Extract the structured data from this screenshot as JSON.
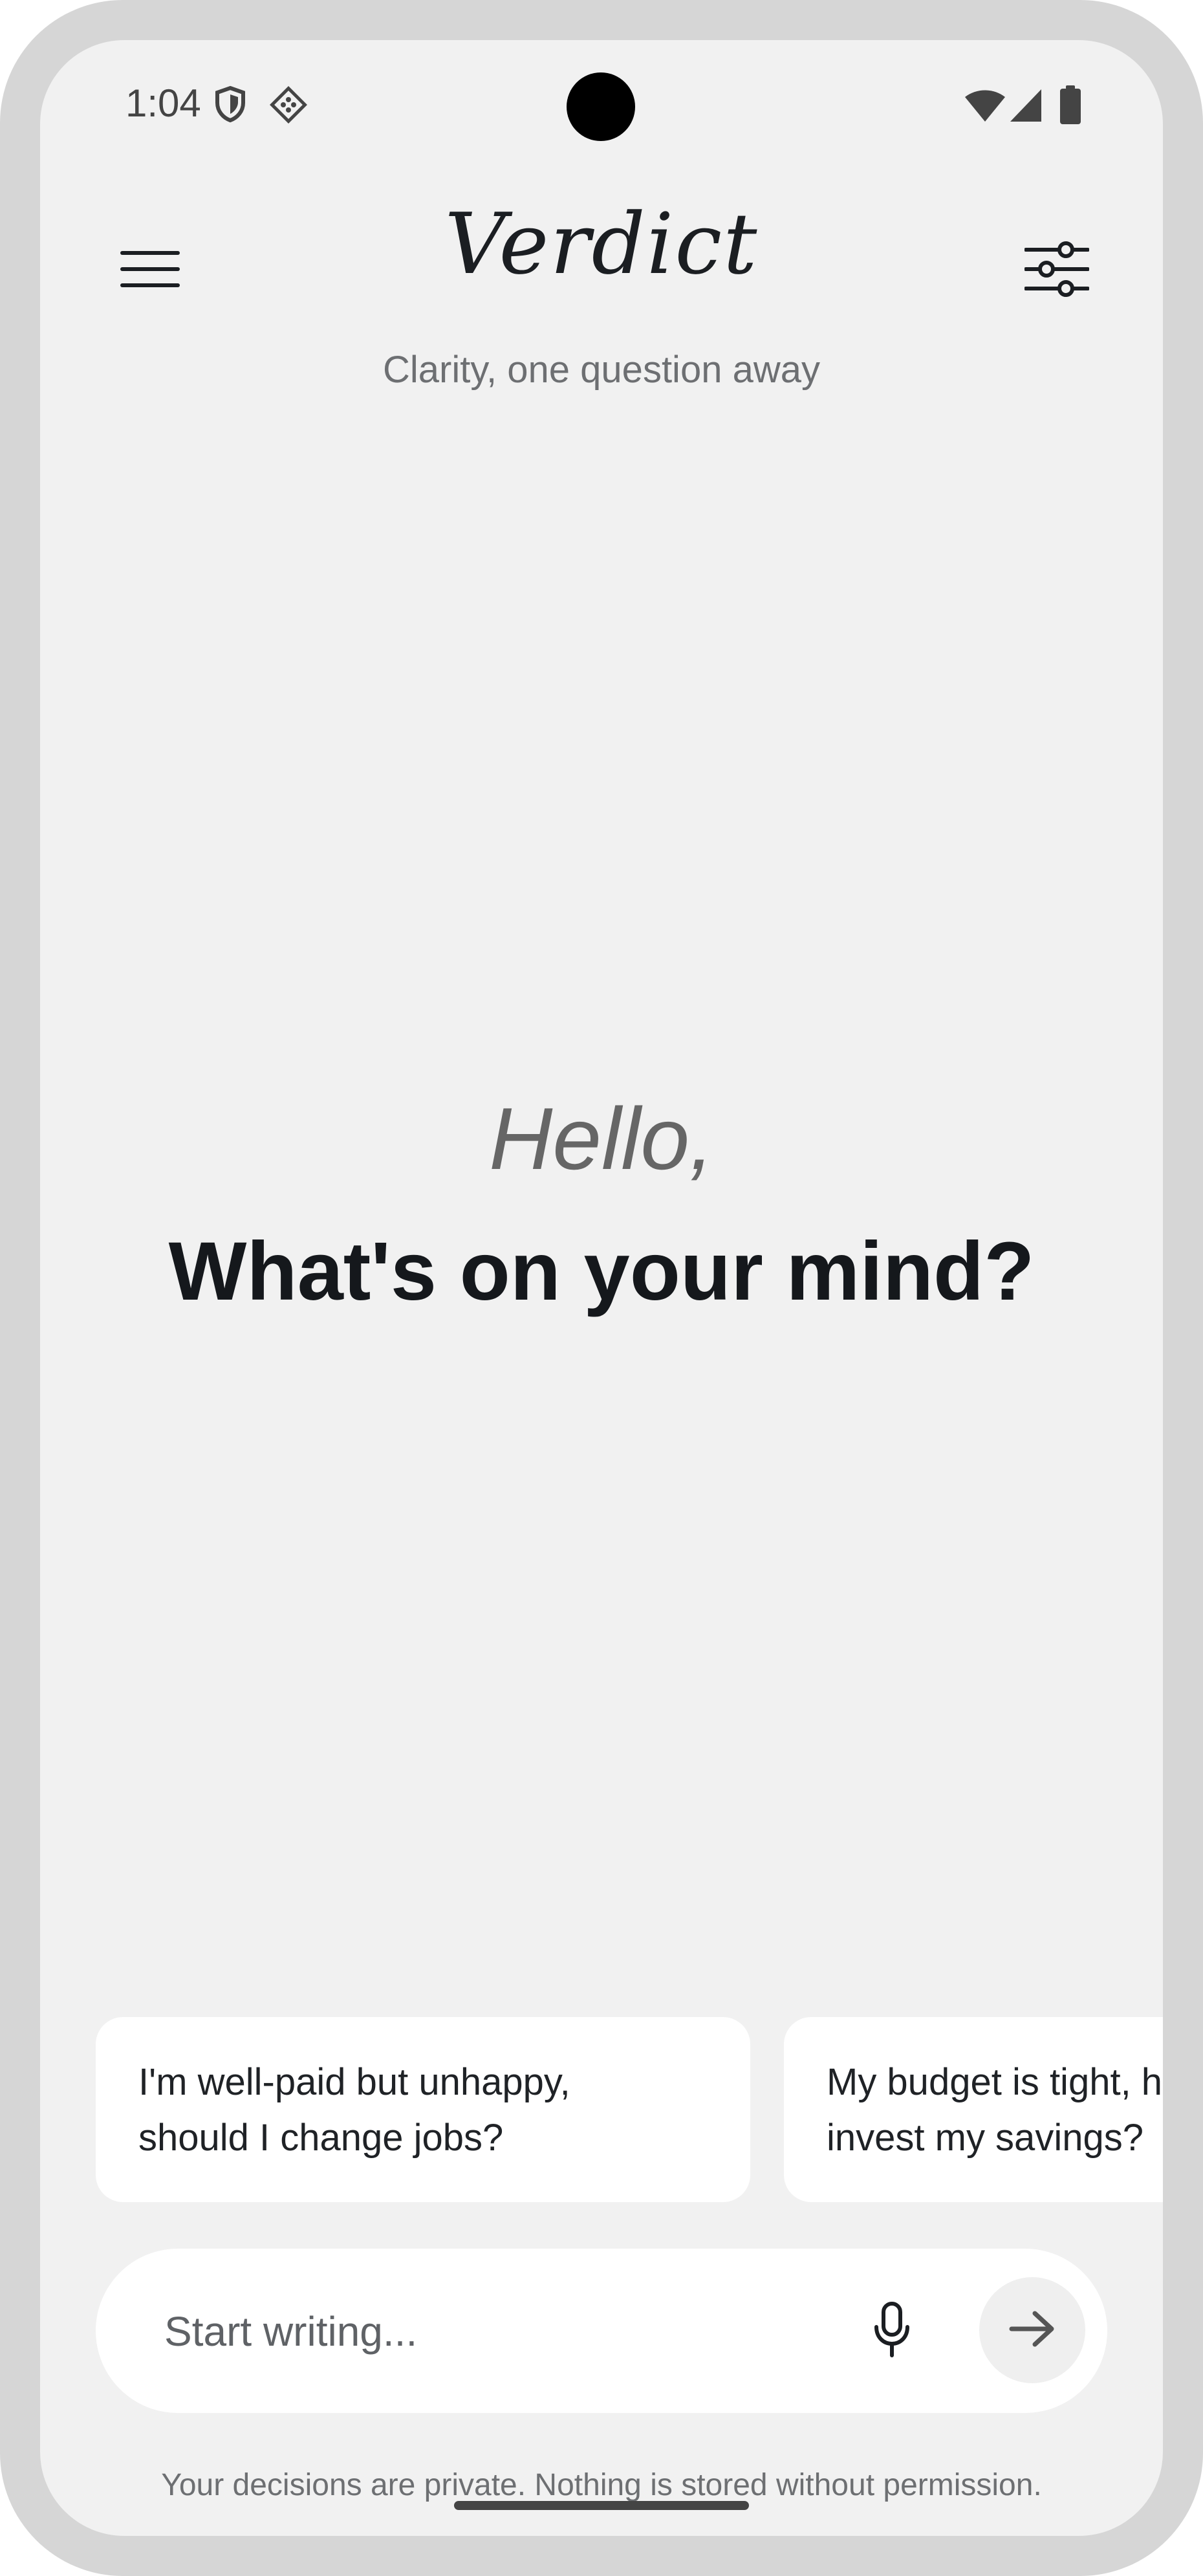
{
  "status_bar": {
    "time": "1:04",
    "icons": [
      "shield-icon",
      "diamond-dots-icon",
      "wifi-icon",
      "cellular-signal-icon",
      "battery-icon"
    ]
  },
  "header": {
    "brand": "Verdict",
    "tagline": "Clarity, one question away",
    "menu_icon": "hamburger-menu-icon",
    "settings_icon": "sliders-icon"
  },
  "main": {
    "greeting": "Hello,",
    "prompt": "What's on your mind?"
  },
  "suggestions": [
    {
      "text": "I'm well-paid but unhappy,\nshould I change jobs?"
    },
    {
      "text": "My budget is tight, h\ninvest my savings?"
    }
  ],
  "composer": {
    "placeholder": "Start writing...",
    "mic_icon": "microphone-icon",
    "send_icon": "arrow-right-icon"
  },
  "footer": {
    "privacy_note": "Your decisions are private. Nothing is stored without permission."
  },
  "colors": {
    "background": "#f1f1f1",
    "frame": "#d6d6d6",
    "text_primary": "#15181c",
    "text_secondary": "#6d6f72",
    "card": "#ffffff"
  }
}
